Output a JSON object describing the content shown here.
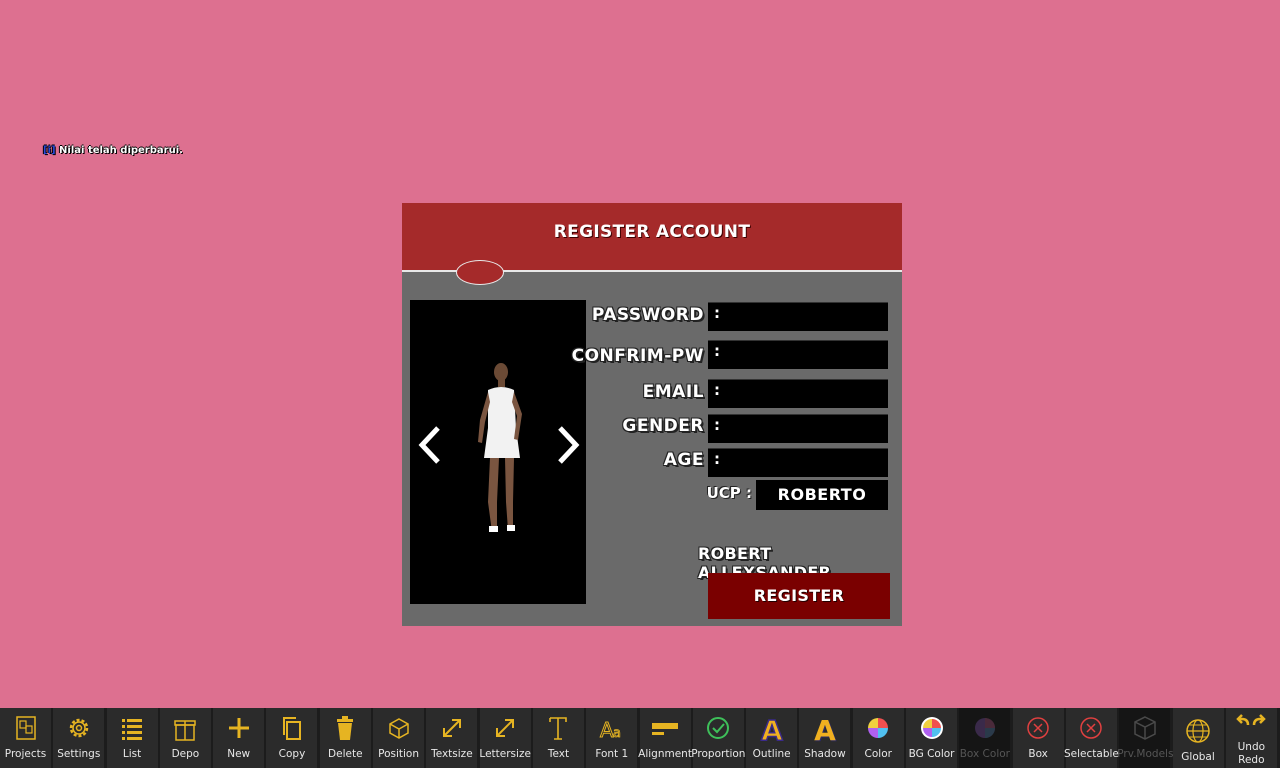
{
  "notice": {
    "tag": "[i]",
    "text": " Nilai telah diperbarui."
  },
  "dialog": {
    "title": "REGISTER ACCOUNT",
    "fields": [
      {
        "label": "PASSWORD",
        "value": ":"
      },
      {
        "label": "CONFRIM-PW",
        "value": ":"
      },
      {
        "label": "EMAIL",
        "value": ":"
      },
      {
        "label": "GENDER",
        "value": ":"
      },
      {
        "label": "AGE",
        "value": ":"
      }
    ],
    "ucp_label": "UCP :",
    "ucp_value": "ROBERTO",
    "character_name": "ROBERT ALLEXSANDER",
    "register_label": "REGISTER",
    "prev_icon": "chevron-left-icon",
    "next_icon": "chevron-right-icon"
  },
  "toolbar": {
    "items": [
      {
        "label": "Projects",
        "icon": "projects-icon",
        "enabled": true
      },
      {
        "label": "Settings",
        "icon": "gear-icon",
        "enabled": true
      },
      {
        "label": "List",
        "icon": "list-icon",
        "enabled": true
      },
      {
        "label": "Depo",
        "icon": "gift-icon",
        "enabled": true
      },
      {
        "label": "New",
        "icon": "plus-icon",
        "enabled": true
      },
      {
        "label": "Copy",
        "icon": "copy-icon",
        "enabled": true
      },
      {
        "label": "Delete",
        "icon": "trash-icon",
        "enabled": true
      },
      {
        "label": "Position",
        "icon": "cube-icon",
        "enabled": true
      },
      {
        "label": "Textsize",
        "icon": "resize-icon",
        "enabled": true
      },
      {
        "label": "Lettersize",
        "icon": "resize-icon",
        "enabled": true
      },
      {
        "label": "Text",
        "icon": "text-icon",
        "enabled": true
      },
      {
        "label": "Font 1",
        "icon": "font-icon",
        "enabled": true
      },
      {
        "label": "Alignment",
        "icon": "align-icon",
        "enabled": true
      },
      {
        "label": "Proportion",
        "icon": "check-circle-icon",
        "enabled": true
      },
      {
        "label": "Outline",
        "icon": "outline-a-icon",
        "enabled": true
      },
      {
        "label": "Shadow",
        "icon": "shadow-a-icon",
        "enabled": true
      },
      {
        "label": "Color",
        "icon": "color-wheel-icon",
        "enabled": true
      },
      {
        "label": "BG Color",
        "icon": "color-wheel-icon",
        "enabled": true
      },
      {
        "label": "Box Color",
        "icon": "color-wheel-icon",
        "enabled": false
      },
      {
        "label": "Box",
        "icon": "x-circle-icon",
        "enabled": true
      },
      {
        "label": "Selectable",
        "icon": "x-circle-icon",
        "enabled": true
      },
      {
        "label": "Prv.Models",
        "icon": "model-box-icon",
        "enabled": false
      },
      {
        "label": "Global",
        "icon": "globe-icon",
        "enabled": true
      },
      {
        "label": "Undo Redo",
        "icon": "undo-redo-icon",
        "enabled": true
      }
    ]
  }
}
